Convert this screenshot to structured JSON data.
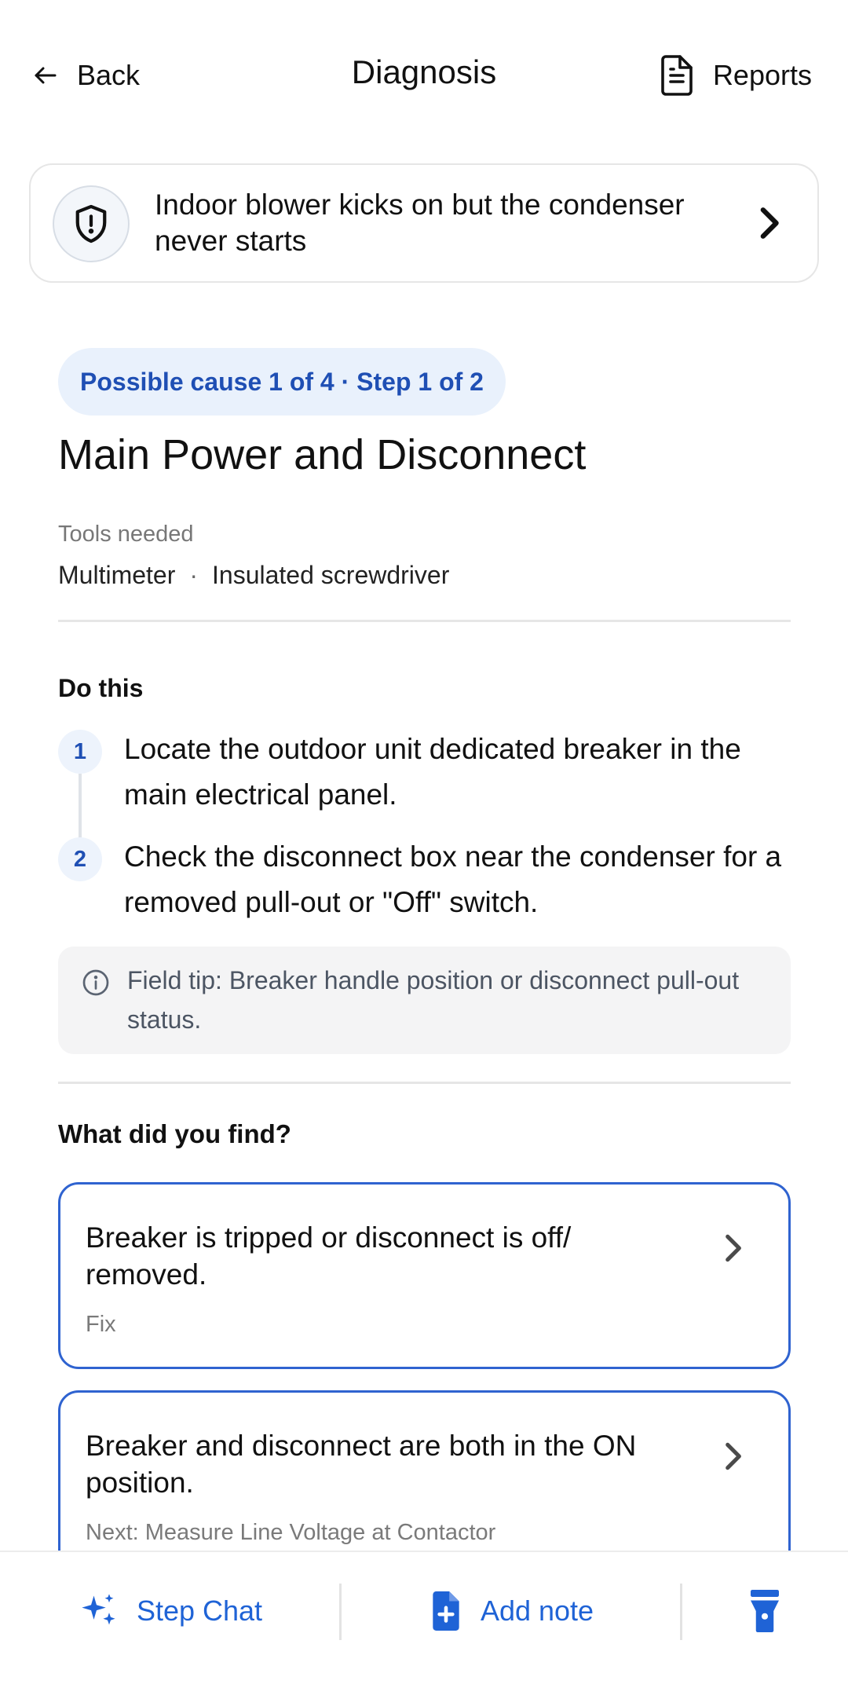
{
  "header": {
    "back_label": "Back",
    "title": "Diagnosis",
    "reports_label": "Reports"
  },
  "problem": {
    "text": "Indoor blower kicks on but the condenser never starts",
    "icon": "shield-alert-icon"
  },
  "cause": {
    "badge": "Possible cause 1 of 4 · Step 1 of 2",
    "title": "Main Power and Disconnect"
  },
  "tools": {
    "label": "Tools needed",
    "items": [
      "Multimeter",
      "Insulated screwdriver"
    ],
    "separator": "·"
  },
  "do_this": {
    "label": "Do this",
    "steps": [
      {
        "num": "1",
        "text": "Locate the outdoor unit dedicated breaker in the main electrical panel."
      },
      {
        "num": "2",
        "text": "Check the disconnect box near the condenser for a removed pull-out or \"Off\" switch."
      }
    ]
  },
  "tip": {
    "text": "Field tip: Breaker handle position or disconnect pull-out status."
  },
  "find": {
    "label": "What did you find?",
    "options": [
      {
        "title": "Breaker is tripped or disconnect is off/ removed.",
        "sub": "Fix"
      },
      {
        "title": "Breaker and disconnect are both in the ON position.",
        "sub": "Next: Measure Line Voltage at Contactor"
      }
    ]
  },
  "bottom_bar": {
    "chat_label": "Step Chat",
    "note_label": "Add note",
    "flashlight_icon": "flashlight-icon"
  },
  "colors": {
    "accent": "#1f63d6",
    "badge_bg": "#e9f1fc",
    "badge_text": "#1f4fb4",
    "tip_bg": "#f4f4f5"
  }
}
